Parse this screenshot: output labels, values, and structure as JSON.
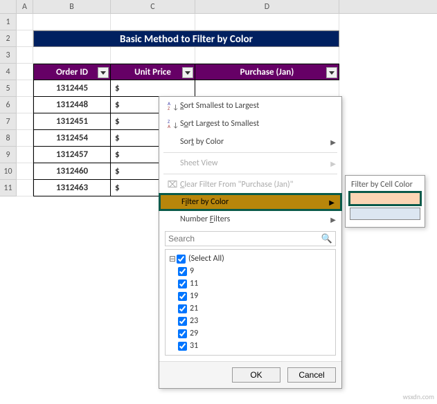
{
  "columns": [
    "A",
    "B",
    "C",
    "D"
  ],
  "rows": [
    "1",
    "2",
    "3",
    "4",
    "5",
    "6",
    "7",
    "8",
    "9",
    "10",
    "11"
  ],
  "title": "Basic Method to Filter by Color",
  "headers": {
    "B": "Order ID",
    "C": "Unit Price",
    "D": "Purchase (Jan)"
  },
  "data_rows": [
    {
      "order_id": "1312445",
      "unit_price": "$"
    },
    {
      "order_id": "1312448",
      "unit_price": "$"
    },
    {
      "order_id": "1312451",
      "unit_price": "$"
    },
    {
      "order_id": "1312454",
      "unit_price": "$"
    },
    {
      "order_id": "1312457",
      "unit_price": "$"
    },
    {
      "order_id": "1312460",
      "unit_price": "$"
    },
    {
      "order_id": "1312463",
      "unit_price": "$"
    }
  ],
  "menu": {
    "sort_asc": "Sort Smallest to Largest",
    "sort_desc": "Sort Largest to Smallest",
    "sort_by_color": "Sort by Color",
    "sheet_view": "Sheet View",
    "clear_filter": "Clear Filter From \"Purchase (Jan)\"",
    "filter_by_color": "Filter by Color",
    "number_filters": "Number Filters",
    "search_placeholder": "Search",
    "select_all": "(Select All)",
    "values": [
      "9",
      "11",
      "19",
      "21",
      "23",
      "29",
      "31"
    ],
    "ok": "OK",
    "cancel": "Cancel"
  },
  "submenu": {
    "title": "Filter by Cell Color",
    "colors": [
      "#fcd5b4",
      "#dce6f1"
    ]
  },
  "watermark": "wsxdn.com"
}
